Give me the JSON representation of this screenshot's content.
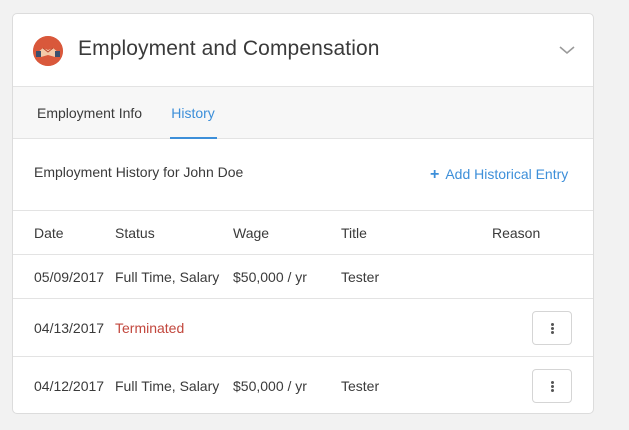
{
  "header": {
    "title": "Employment and Compensation",
    "icon": "handshake-icon",
    "toggle_icon": "chevron-down-icon"
  },
  "tabs": [
    {
      "label": "Employment Info",
      "active": false
    },
    {
      "label": "History",
      "active": true
    }
  ],
  "history": {
    "title": "Employment History for John Doe",
    "add_label": "Add Historical Entry",
    "columns": [
      "Date",
      "Status",
      "Wage",
      "Title",
      "Reason"
    ],
    "rows": [
      {
        "date": "05/09/2017",
        "status": "Full Time, Salary",
        "wage": "$50,000 / yr",
        "title": "Tester",
        "reason": ""
      },
      {
        "date": "04/13/2017",
        "status": "Terminated",
        "wage": "",
        "title": "",
        "reason": ""
      },
      {
        "date": "04/12/2017",
        "status": "Full Time, Salary",
        "wage": "$50,000 / yr",
        "title": "Tester",
        "reason": ""
      }
    ]
  },
  "colors": {
    "accent": "#3d8fd9",
    "terminated": "#c2473d",
    "icon_bg": "#d9583b"
  }
}
